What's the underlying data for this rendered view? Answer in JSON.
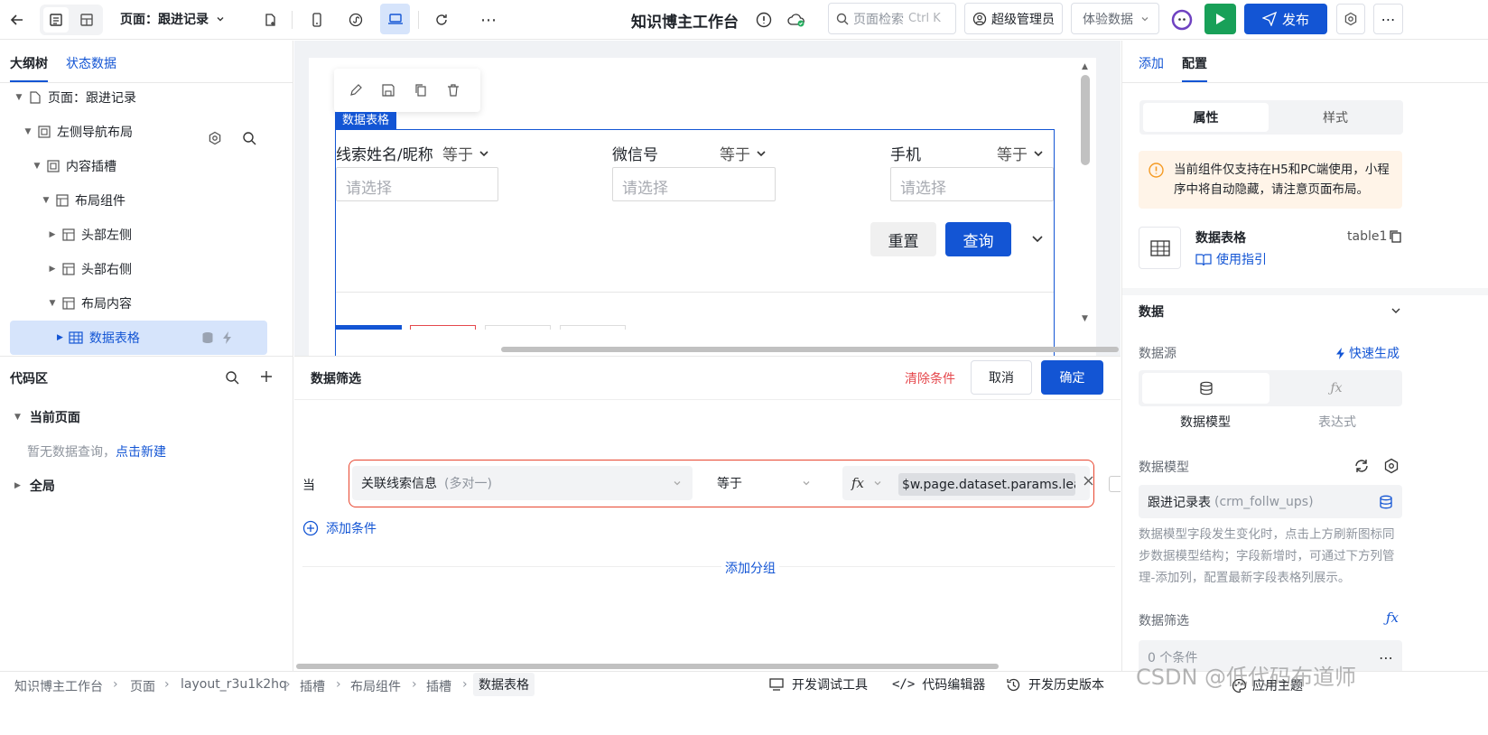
{
  "topbar": {
    "page_select": "页面：跟进记录",
    "app_title": "知识博主工作台",
    "search_placeholder": "页面检索",
    "search_shortcut": "Ctrl K",
    "user": "超级管理员",
    "env": "体验数据",
    "publish": "发布"
  },
  "left": {
    "tabs": [
      "大纲树",
      "状态数据"
    ],
    "tree": [
      {
        "label": "页面：跟进记录"
      },
      {
        "label": "左侧导航布局"
      },
      {
        "label": "内容插槽"
      },
      {
        "label": "布局组件"
      },
      {
        "label": "头部左侧"
      },
      {
        "label": "头部右侧"
      },
      {
        "label": "布局内容"
      },
      {
        "label": "数据表格"
      }
    ],
    "code_title": "代码区",
    "current_page": "当前页面",
    "empty_text": "暂无数据查询，",
    "create_link": "点击新建",
    "global": "全局"
  },
  "canvas": {
    "component_tag": "数据表格",
    "filters": [
      {
        "label": "线索姓名/昵称",
        "op": "等于",
        "placeholder": "请选择"
      },
      {
        "label": "微信号",
        "op": "等于",
        "placeholder": "请选择"
      },
      {
        "label": "手机",
        "op": "等于",
        "placeholder": "请选择"
      }
    ],
    "reset": "重置",
    "query": "查询"
  },
  "filter_panel": {
    "title": "数据筛选",
    "clear": "清除条件",
    "cancel": "取消",
    "confirm": "确定",
    "when": "当",
    "field": "关联线索信息",
    "field_hint": "(多对一)",
    "op": "等于",
    "fx": "fx",
    "value": "$w.page.dataset.params.lea...",
    "add_condition": "添加条件",
    "add_group": "添加分组"
  },
  "right": {
    "tabs": [
      "添加",
      "配置"
    ],
    "seg": [
      "属性",
      "样式"
    ],
    "notice": "当前组件仅支持在H5和PC端使用，小程序中将自动隐藏，请注意页面布局。",
    "comp_name": "数据表格",
    "comp_id": "table1",
    "guide": "使用指引",
    "data_section": "数据",
    "datasource_label": "数据源",
    "quick_gen": "快速生成",
    "ds_options": [
      "数据模型",
      "表达式"
    ],
    "model_label": "数据模型",
    "model_value": "跟进记录表",
    "model_code": "(crm_follw_ups)",
    "model_hint": "数据模型字段发生变化时，点击上方刷新图标同步数据模型结构；字段新增时，可通过下方列管理-添加列，配置最新字段表格列展示。",
    "filter_label": "数据筛选",
    "filter_count": "0 个条件"
  },
  "bottom": {
    "crumbs": [
      "知识博主工作台",
      "页面",
      "layout_r3u1k2hq",
      "插槽",
      "布局组件",
      "插槽",
      "数据表格"
    ],
    "tools": [
      "开发调试工具",
      "代码编辑器",
      "开发历史版本"
    ],
    "theme": "应用主题",
    "watermark": "CSDN @低代码布道师"
  },
  "colors": {
    "primary": "#1355d4",
    "danger": "#e5484d",
    "selected_bg": "#d6e4fb",
    "notice_bg": "#fff4e8"
  }
}
